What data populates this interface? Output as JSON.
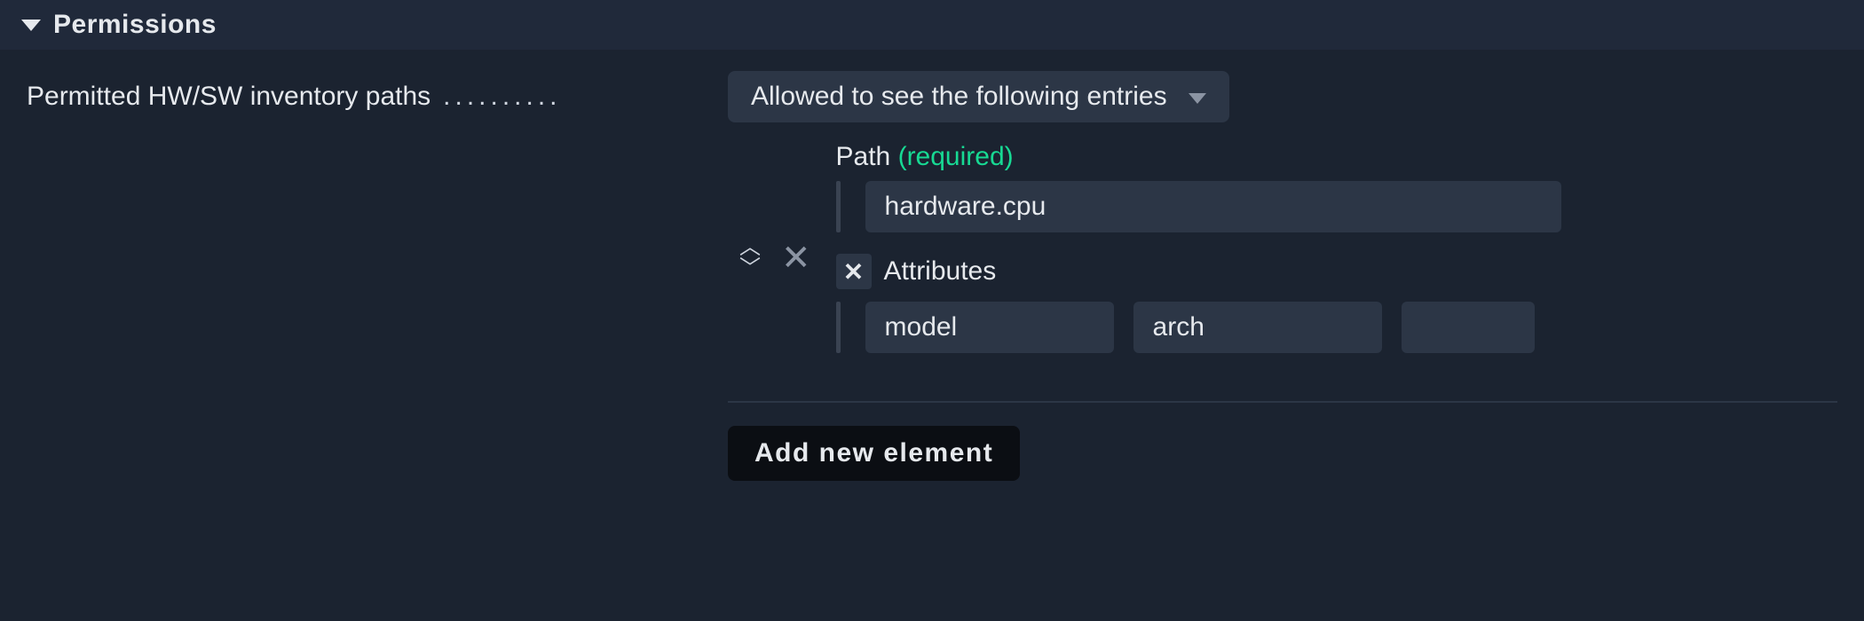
{
  "section": {
    "title": "Permissions"
  },
  "setting": {
    "label": "Permitted HW/SW inventory paths",
    "dropdown_value": "Allowed to see the following entries"
  },
  "element": {
    "path_label": "Path",
    "required_hint": "(required)",
    "path_value": "hardware.cpu",
    "attributes_label": "Attributes",
    "attributes": [
      "model",
      "arch",
      ""
    ]
  },
  "add_button": "Add new element",
  "glyphs": {
    "close": "✕",
    "up": "︿",
    "down": "﹀"
  }
}
